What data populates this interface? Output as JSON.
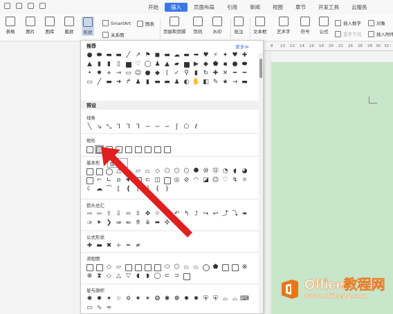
{
  "tabs": [
    "开始",
    "插入",
    "页面布局",
    "引用",
    "审阅",
    "视图",
    "章节",
    "开发工具",
    "云服务"
  ],
  "active_tab": "插入",
  "ribbon": {
    "table": "表格",
    "picture": "图片",
    "gallery": "图库",
    "screenshot": "截屏",
    "shape": "形状",
    "smartart": "SmartArt",
    "chart": "图表",
    "relation": "关系图",
    "header_footer": "页眉和页脚",
    "page_num": "页码",
    "watermark": "水印",
    "comment": "批注",
    "textbox": "文本框",
    "art": "艺术字",
    "symbol": "符号",
    "formula": "公式",
    "insert_num": "插入数字",
    "obj": "对象",
    "first_sink": "首字下沉",
    "insert_attach": "插入附件"
  },
  "panel": {
    "recommended": "推荐",
    "more": "更多≫",
    "preset": "预设",
    "lines": "线条",
    "rect": "矩形",
    "basic": "基本形",
    "arrows": "箭头总汇",
    "formula_shapes": "公式形状",
    "flowchart": "流程图",
    "stars": "星与旗帜"
  },
  "tooltip": "圆",
  "ruler_marks": [
    "8",
    "10",
    "12",
    "14",
    "16",
    "18",
    "20",
    "22",
    "24",
    "26",
    "28",
    "30",
    "32"
  ],
  "logo": {
    "title": "Office教程网",
    "url": "www.office26.com",
    "brand_color": "#e8761c"
  },
  "colors": {
    "accent": "#3b78e7",
    "page": "#c8e6c9",
    "arrow": "#e02020"
  }
}
